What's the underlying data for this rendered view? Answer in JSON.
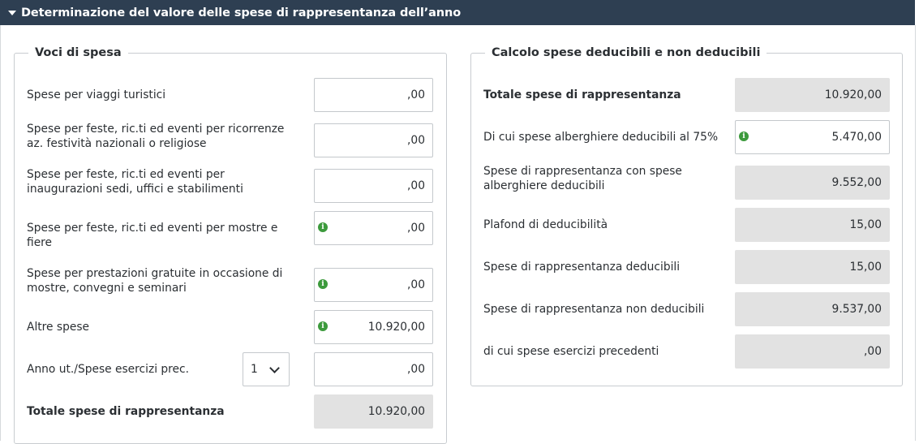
{
  "header": {
    "title": "Determinazione del valore delle spese di rappresentanza dell’anno"
  },
  "left": {
    "legend": "Voci di spesa",
    "rows": [
      {
        "label": "Spese per viaggi turistici",
        "value": ",00"
      },
      {
        "label": "Spese per feste, ric.ti ed eventi per ricorrenze az. festività nazionali o religiose",
        "value": ",00"
      },
      {
        "label": "Spese per feste, ric.ti ed eventi per inaugurazioni sedi, uffici e stabilimenti",
        "value": ",00"
      },
      {
        "label": "Spese per feste, ric.ti ed eventi per mostre e fiere",
        "value": ",00"
      },
      {
        "label": "Spese per prestazioni gratuite in occasione di mostre, convegni e seminari",
        "value": ",00"
      },
      {
        "label": "Altre spese",
        "value": "10.920,00"
      },
      {
        "label": "Anno ut./Spese esercizi prec.",
        "select_value": "1",
        "value": ",00"
      }
    ],
    "total": {
      "label": "Totale spese di rappresentanza",
      "value": "10.920,00"
    }
  },
  "right": {
    "legend": "Calcolo spese deducibili e non deducibili",
    "rows": [
      {
        "label": "Totale spese di rappresentanza",
        "value": "10.920,00"
      },
      {
        "label": "Di cui spese alberghiere deducibili al 75%",
        "value": "5.470,00"
      },
      {
        "label": "Spese di rappresentanza con spese alberghiere deducibili",
        "value": "9.552,00"
      },
      {
        "label": "Plafond di deducibilità",
        "value": "15,00"
      },
      {
        "label": "Spese di rappresentanza deducibili",
        "value": "15,00"
      },
      {
        "label": "Spese di rappresentanza non deducibili",
        "value": "9.537,00"
      },
      {
        "label": "di cui spese esercizi precedenti",
        "value": ",00"
      }
    ]
  },
  "icons": {
    "info": "info-icon",
    "collapse": "caret-down-icon",
    "dropdown": "chevron-down-icon"
  },
  "colors": {
    "header_bg": "#2e3f52",
    "info_green": "#3c9a3c",
    "readonly_bg": "#e2e2e2"
  }
}
